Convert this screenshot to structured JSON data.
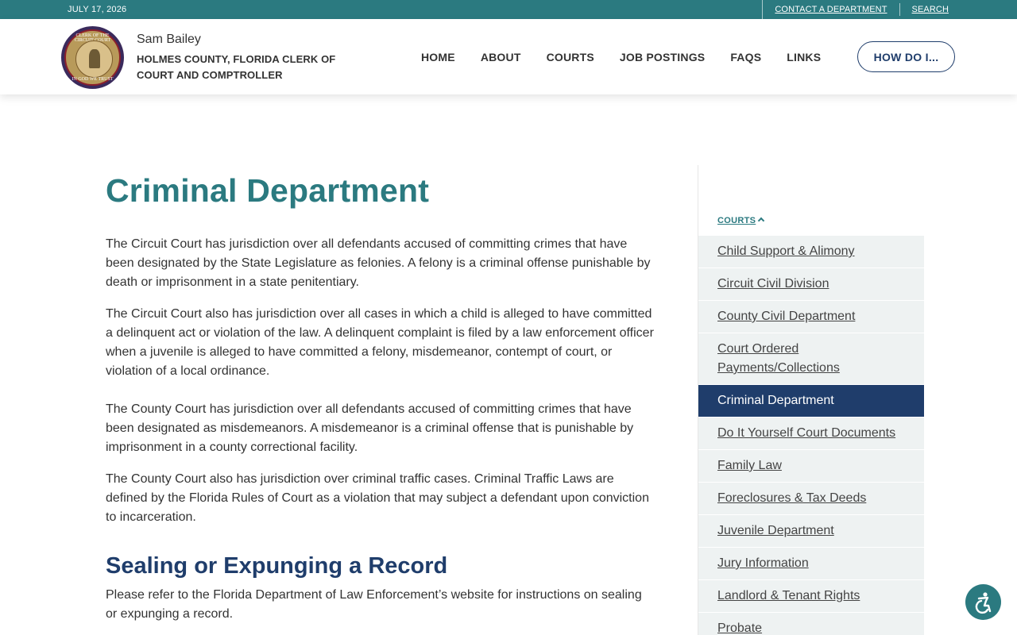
{
  "topbar": {
    "date": "JULY 17, 2026",
    "contact_label": "CONTACT A DEPARTMENT",
    "search_label": "SEARCH"
  },
  "header": {
    "seal_text_top": "CLERK OF THE CIRCUIT COURT",
    "seal_text_bottom": "IN GOD WE TRUST",
    "name": "Sam Bailey",
    "title": "HOLMES COUNTY, FLORIDA CLERK OF COURT AND COMPTROLLER",
    "nav": [
      "HOME",
      "ABOUT",
      "COURTS",
      "JOB POSTINGS",
      "FAQS",
      "LINKS"
    ],
    "how_do_i": "HOW DO I..."
  },
  "main": {
    "heading": "Criminal Department",
    "paragraphs": [
      "The Circuit Court has jurisdiction over all defendants accused of committing crimes that have been designated by the State Legislature as felonies. A felony is a criminal offense punishable by death or imprisonment in a state penitentiary.",
      "The Circuit Court also has jurisdiction over all cases in which a child is alleged to have committed a delinquent act or violation of the law. A delinquent complaint is filed by a law enforcement officer when a juvenile is alleged to have committed a felony, misdemeanor, contempt of court, or violation of a local ordinance.",
      "The County Court has jurisdiction over all defendants accused of committing crimes that have been designated as misdemeanors. A misdemeanor is a criminal offense that is punishable by imprisonment in a county correctional facility.",
      "The County Court also has jurisdiction over criminal traffic cases. Criminal Traffic Laws are defined by the Florida Rules of Court as a violation that may subject a defendant upon conviction to incarceration."
    ],
    "subheading": "Sealing or Expunging a Record",
    "sealing_text": "Please refer to the Florida Department of Law Enforcement’s website for instructions on sealing or expunging a record."
  },
  "sidebar": {
    "heading": "COURTS",
    "items": [
      {
        "label": "Child Support & Alimony",
        "active": false
      },
      {
        "label": "Circuit Civil Division",
        "active": false
      },
      {
        "label": "County Civil Department",
        "active": false
      },
      {
        "label": "Court Ordered Payments/Collections",
        "active": false
      },
      {
        "label": "Criminal Department",
        "active": true
      },
      {
        "label": "Do It Yourself Court Documents",
        "active": false
      },
      {
        "label": "Family Law",
        "active": false
      },
      {
        "label": "Foreclosures & Tax Deeds",
        "active": false
      },
      {
        "label": "Juvenile Department",
        "active": false
      },
      {
        "label": "Jury Information",
        "active": false
      },
      {
        "label": "Landlord & Tenant Rights",
        "active": false
      },
      {
        "label": "Probate",
        "active": false
      }
    ]
  },
  "colors": {
    "teal": "#2b7a80",
    "navy": "#1f3d6b",
    "sidebar_bg": "#eef2f2"
  },
  "icons": {
    "accessibility": "accessibility-icon",
    "chevron": "chevron-up-icon"
  }
}
